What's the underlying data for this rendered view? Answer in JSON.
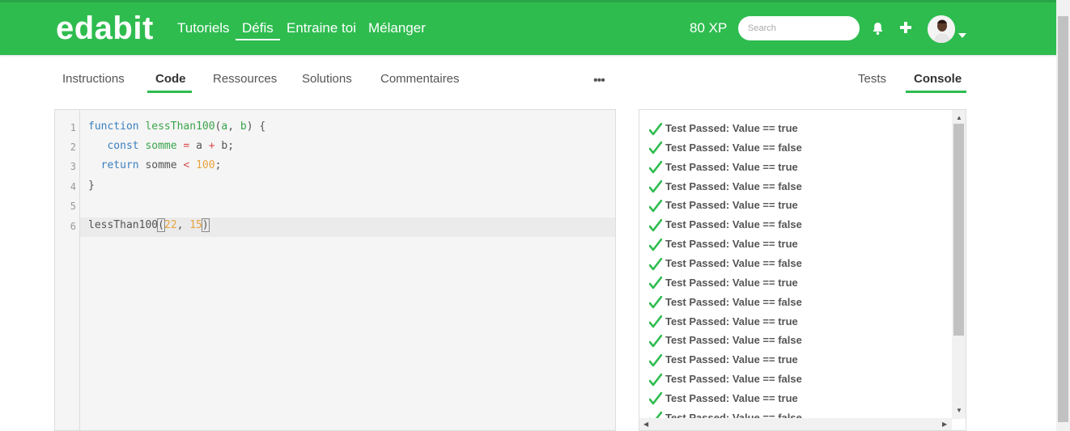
{
  "header": {
    "logo": "edabit",
    "nav": [
      "Tutoriels",
      "Défis",
      "Entraine toi",
      "Mélanger"
    ],
    "active_nav": "Défis",
    "xp": "80 XP",
    "search_placeholder": "Search",
    "brand_color": "#2ebc4f"
  },
  "tabs_left": [
    "Instructions",
    "Code",
    "Ressources",
    "Solutions",
    "Commentaires"
  ],
  "tabs_left_active": "Code",
  "more_label": "•••",
  "tabs_right": [
    "Tests",
    "Console"
  ],
  "tabs_right_active": "Console",
  "editor": {
    "line_numbers": [
      "1",
      "2",
      "3",
      "4",
      "5",
      "6"
    ],
    "lines": [
      "function lessThan100(a, b) {",
      "   const somme = a + b;",
      "  return somme < 100;",
      "}",
      "",
      "lessThan100(22, 15)"
    ]
  },
  "console": {
    "results": [
      "Test Passed: Value == true",
      "Test Passed: Value == false",
      "Test Passed: Value == true",
      "Test Passed: Value == false",
      "Test Passed: Value == true",
      "Test Passed: Value == false",
      "Test Passed: Value == true",
      "Test Passed: Value == false",
      "Test Passed: Value == true",
      "Test Passed: Value == false",
      "Test Passed: Value == true",
      "Test Passed: Value == false",
      "Test Passed: Value == true",
      "Test Passed: Value == false",
      "Test Passed: Value == true",
      "Test Passed: Value == false"
    ],
    "pass_color": "#2ebc4f"
  },
  "icons": [
    "bell-icon",
    "plus-icon",
    "avatar",
    "chevron-down-icon",
    "check-icon"
  ]
}
